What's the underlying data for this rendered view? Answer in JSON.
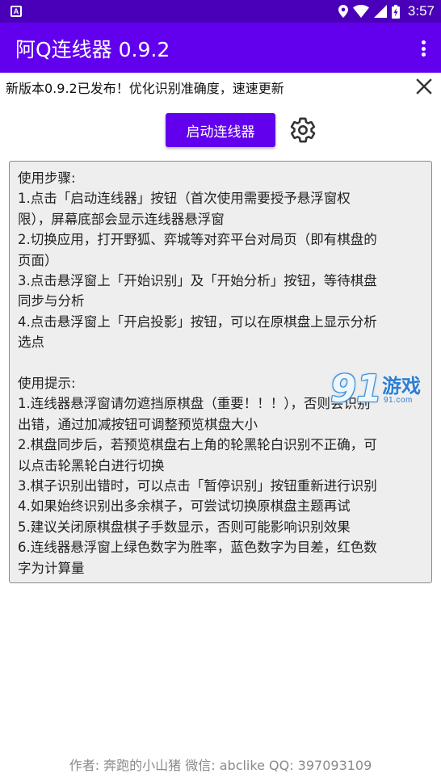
{
  "status_bar": {
    "left_icon_letter": "A",
    "time": "3:57",
    "icons": [
      "location-icon",
      "wifi-icon",
      "signal-icon",
      "battery-charging-icon"
    ]
  },
  "app_bar": {
    "title": "阿Q连线器 0.9.2",
    "overflow_icon": "more-vert-icon"
  },
  "notice": {
    "text": "新版本0.9.2已发布！优化识别准确度，速速更新",
    "close_icon": "close-icon"
  },
  "actions": {
    "start_button_label": "启动连线器",
    "settings_icon": "gear-icon"
  },
  "instructions": {
    "lines": [
      "使用步骤:",
      " 1.点击「启动连线器」按钮（首次使用需要授予悬浮窗权",
      " 限），屏幕底部会显示连线器悬浮窗",
      " 2.切换应用，打开野狐、弈城等对弈平台对局页（即有棋盘的",
      " 页面）",
      " 3.点击悬浮窗上「开始识别」及「开始分析」按钮，等待棋盘",
      " 同步与分析",
      " 4.点击悬浮窗上「开启投影」按钮，可以在原棋盘上显示分析",
      " 选点",
      "",
      " 使用提示:",
      " 1.连线器悬浮窗请勿遮挡原棋盘（重要！！！），否则会识别",
      " 出错，通过加减按钮可调整预览棋盘大小",
      " 2.棋盘同步后，若预览棋盘右上角的轮黑轮白识别不正确，可",
      " 以点击轮黑轮白进行切换",
      " 3.棋子识别出错时，可以点击「暂停识别」按钮重新进行识别",
      " 4.如果始终识别出多余棋子，可尝试切换原棋盘主题再试",
      " 5.建议关闭原棋盘棋子手数显示，否则可能影响识别效果",
      " 6.连线器悬浮窗上绿色数字为胜率，蓝色数字为目差，红色数",
      " 字为计算量"
    ]
  },
  "watermark": {
    "logo_number": "91",
    "logo_text": "游戏",
    "url": "91.com"
  },
  "footer": {
    "text": "作者: 奔跑的小山猪 微信: abclike QQ: 397093109"
  },
  "colors": {
    "status_bar": "#4a00b8",
    "app_bar": "#6200ee",
    "button": "#6200ee",
    "panel_bg": "#eeeeee",
    "footer_text": "#8a8a8a"
  }
}
